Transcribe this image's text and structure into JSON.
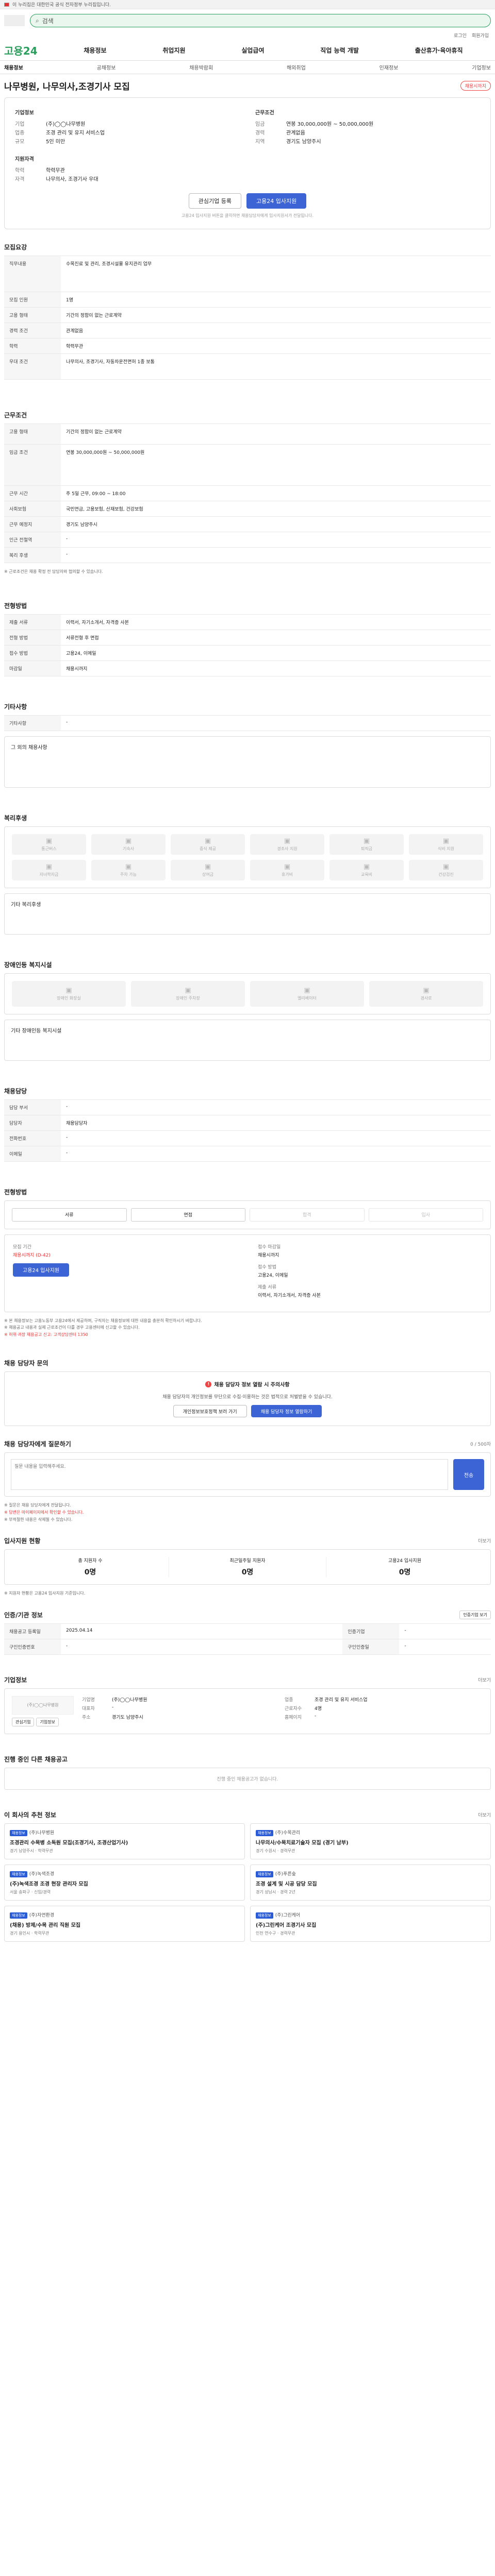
{
  "gov_banner": "이 누리집은 대한민국 공식 전자정부 누리집입니다.",
  "search": {
    "placeholder": "검색"
  },
  "util_links": [
    "로그인",
    "회원가입"
  ],
  "brand": "고용24",
  "gnb": [
    "채용정보",
    "취업지원",
    "실업급여",
    "직업 능력 개발",
    "출산휴가·육아휴직"
  ],
  "subnav": [
    "채용정보",
    "공채정보",
    "채용박람회",
    "해외취업",
    "인재정보",
    "기업정보"
  ],
  "job": {
    "title": "나무병원, 나무의사,조경기사 모집",
    "status_pill": "채용시까지",
    "company_label": "기업정보",
    "company_rows": [
      {
        "k": "기업",
        "v": "(주)◯◯나무병원"
      },
      {
        "k": "업종",
        "v": "조경 관리 및 유지 서비스업"
      },
      {
        "k": "규모",
        "v": "5인 미만"
      }
    ],
    "cond_label": "근무조건",
    "cond_rows": [
      {
        "k": "임금",
        "v": "연봉 30,000,000원 ~ 50,000,000원"
      },
      {
        "k": "경력",
        "v": "관계없음"
      },
      {
        "k": "지역",
        "v": "경기도 남양주시"
      }
    ],
    "req_label": "지원자격",
    "req_rows": [
      {
        "k": "학력",
        "v": "학력무관"
      },
      {
        "k": "자격",
        "v": "나무의사, 조경기사 우대"
      }
    ],
    "btn_interest": "관심기업 등록",
    "btn_apply": "고용24 입사지원",
    "notice": "고용24 입사지원 버튼을 클릭하면 채용담당자에게 입사지원서가 전달됩니다."
  },
  "recruit": {
    "heading": "모집요강",
    "rows": [
      {
        "th": "직무내용",
        "td": "수목진료 및 관리, 조경시설물 유지관리 업무"
      },
      {
        "th": "모집 인원",
        "td": "1명"
      },
      {
        "th": "고용 형태",
        "td": "기간의 정함이 없는 근로계약"
      },
      {
        "th": "경력 조건",
        "td": "관계없음"
      },
      {
        "th": "학력",
        "td": "학력무관"
      },
      {
        "th": "우대 조건",
        "td": "나무의사, 조경기사, 자동차운전면허 1종 보통"
      }
    ]
  },
  "work": {
    "heading": "근무조건",
    "rows": [
      {
        "th": "고용 형태",
        "td": "기간의 정함이 없는 근로계약"
      },
      {
        "th": "임금 조건",
        "td": "연봉 30,000,000원 ~ 50,000,000원"
      },
      {
        "th": "근무 시간",
        "td": "주 5일 근무, 09:00 ~ 18:00"
      },
      {
        "th": "사회보험",
        "td": "국민연금, 고용보험, 산재보험, 건강보험"
      },
      {
        "th": "근무 예정지",
        "td": "경기도 남양주시"
      },
      {
        "th": "인근 전철역",
        "td": "-"
      },
      {
        "th": "복리 후생",
        "td": "-"
      }
    ],
    "footnote": "※ 근로조건은 채용 확정 전 담당자와 협의할 수 있습니다."
  },
  "docs": {
    "heading": "전형방법",
    "rows": [
      {
        "th": "제출 서류",
        "td": "이력서, 자기소개서, 자격증 사본"
      },
      {
        "th": "전형 방법",
        "td": "서류전형 후 면접"
      },
      {
        "th": "접수 방법",
        "td": "고용24, 이메일"
      },
      {
        "th": "마감일",
        "td": "채용시까지"
      }
    ]
  },
  "extra": {
    "heading": "기타사항",
    "rows": [
      {
        "th": "기타사항",
        "td": "-"
      }
    ],
    "empty_note": "그 외의 채용사항"
  },
  "welfare": {
    "heading": "복리후생",
    "items": [
      "통근버스",
      "기숙사",
      "중식 제공",
      "경조사 지원",
      "퇴직금",
      "식비 지원",
      "자녀학자금",
      "주차 가능",
      "상여금",
      "휴가비",
      "교육비",
      "건강검진"
    ],
    "empty_note": "기타 복리후생"
  },
  "disability": {
    "heading": "장애인등 복지시설",
    "items": [
      "장애인 화장실",
      "장애인 주차장",
      "엘리베이터",
      "경사로"
    ],
    "empty_note": "기타 장애인등 복지시설"
  },
  "recruiter": {
    "heading": "채용담당",
    "rows": [
      {
        "th": "담당 부서",
        "td": "-"
      },
      {
        "th": "담당자",
        "td": "채용담당자"
      },
      {
        "th": "전화번호",
        "td": "-"
      },
      {
        "th": "이메일",
        "td": "-"
      }
    ]
  },
  "process": {
    "heading": "전형방법",
    "steps": [
      "서류",
      "면접",
      "합격",
      "입사"
    ],
    "apply_label": "접수 마감일",
    "apply_value": "채용시까지",
    "apply_left_label": "모집 기간",
    "apply_left_value": "채용시까지 (D-42)",
    "apply_btn": "고용24 입사지원",
    "method_label": "접수 방법",
    "method_value": "고용24, 이메일",
    "docs_label": "제출 서류",
    "docs_value": "이력서, 자기소개서, 자격증 사본"
  },
  "fine": [
    "※ 본 채용정보는 고용노동부 고용24에서 제공하며, 구직자는 채용정보에 대한 내용을 충분히 확인하시기 바랍니다.",
    "※ 채용공고 내용과 실제 근로조건이 다를 경우 고용센터에 신고할 수 있습니다.",
    "※ 허위·과장 채용공고 신고: 고객상담센터 1350"
  ],
  "chat": {
    "heading": "채용 담당자 문의",
    "badge": "채용 담당자 정보 열람 시 주의사항",
    "body": "채용 담당자의 개인정보를 무단으로 수집·이용하는 것은 법적으로 처벌받을 수 있습니다.",
    "btn_left": "개인정보보호정책 보러 가기",
    "btn_right": "채용 담당자 정보 열람하기"
  },
  "qna": {
    "heading": "채용 담당자에게 질문하기",
    "counter": "0 / 500자",
    "placeholder": "질문 내용을 입력해주세요.",
    "send": "전송",
    "notes": [
      "※ 질문은 채용 담당자에게 전달됩니다.",
      "※ 답변은 마이페이지에서 확인할 수 있습니다.",
      "※ 부적절한 내용은 삭제될 수 있습니다."
    ]
  },
  "stats": {
    "heading": "입사지원 현황",
    "more": "더보기",
    "items": [
      {
        "label": "총 지원자 수",
        "value": "0명"
      },
      {
        "label": "최근일주일 지원자",
        "value": "0명"
      },
      {
        "label": "고용24 입사지원",
        "value": "0명"
      }
    ],
    "note": "※ 지원자 현황은 고용24 입사지원 기준입니다."
  },
  "meta": {
    "heading": "인증/기관 정보",
    "more": "인증기업 보기",
    "rows": [
      {
        "th": "채용공고 등록일",
        "td": "2025.04.14",
        "th2": "인증기업",
        "td2": "-"
      },
      {
        "th": "구인인증번호",
        "td": "-",
        "th2": "구인인증일",
        "td2": "-"
      }
    ]
  },
  "company": {
    "heading": "기업정보",
    "more": "더보기",
    "logo_text": "(주)◯◯나무병원",
    "rows": [
      {
        "k": "기업명",
        "v": "(주)◯◯나무병원",
        "k2": "업종",
        "v2": "조경 관리 및 유지 서비스업"
      },
      {
        "k": "대표자",
        "v": "-",
        "k2": "근로자수",
        "v2": "4명"
      },
      {
        "k": "주소",
        "v": "경기도 남양주시",
        "k2": "홈페이지",
        "v2": "-"
      }
    ],
    "btn_a": "관심기업",
    "btn_b": "기업정보"
  },
  "other_jobs": {
    "heading": "진행 중인 다른 채용공고",
    "empty": "진행 중인 채용공고가 없습니다."
  },
  "recommend": {
    "heading": "이 회사의 추천 정보",
    "more": "더보기",
    "items": [
      {
        "tag": "채용정보",
        "company": "(주)나무병원",
        "title": "조경관리 수목병 소독원 모집(조경기사, 조경산업기사)",
        "meta": "경기 남양주시 · 학력무관"
      },
      {
        "tag": "채용정보",
        "company": "(주)수목관리",
        "title": "나무의사/수목치료기술자 모집 (경기 남부)",
        "meta": "경기 수원시 · 경력무관"
      },
      {
        "tag": "채용정보",
        "company": "(주)녹색조경",
        "title": "(주)녹색조경 조경 현장 관리자 모집",
        "meta": "서울 송파구 · 신입/경력"
      },
      {
        "tag": "채용정보",
        "company": "(주)푸른숲",
        "title": "조경 설계 및 시공 담당 모집",
        "meta": "경기 성남시 · 경력 2년"
      },
      {
        "tag": "채용정보",
        "company": "(주)자연환경",
        "title": "(채용) 방제/수목 관리 직원 모집",
        "meta": "경기 용인시 · 학력무관"
      },
      {
        "tag": "채용정보",
        "company": "(주)그린케어",
        "title": "(주)그린케어 조경기사 모집",
        "meta": "인천 연수구 · 경력무관"
      }
    ]
  }
}
